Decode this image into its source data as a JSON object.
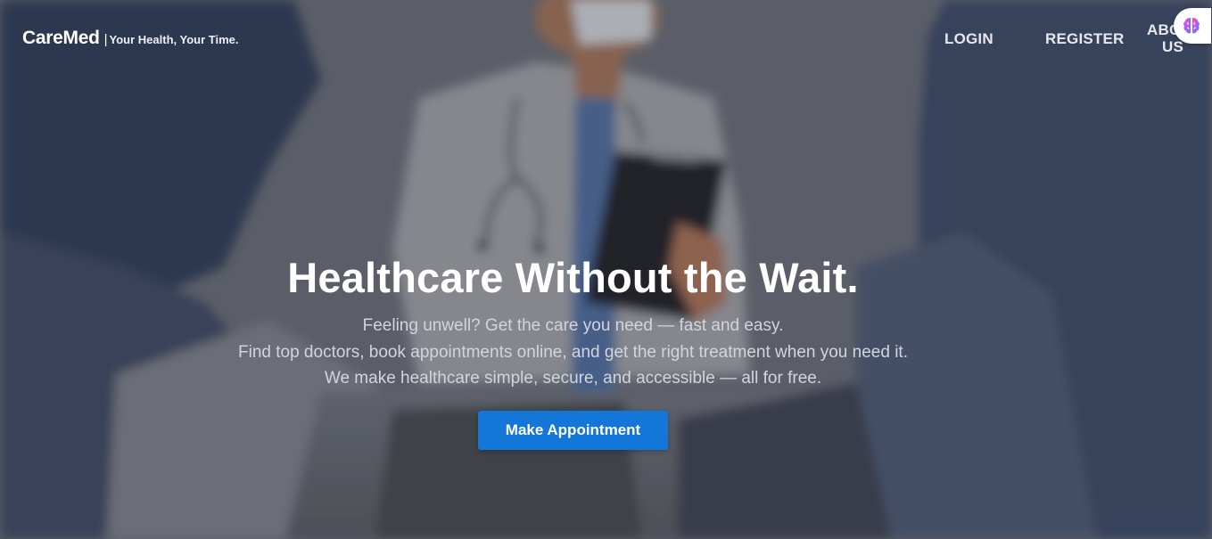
{
  "brand": {
    "name": "CareMed",
    "separator": "|",
    "tagline": "Your Health, Your Time."
  },
  "nav": {
    "login": "LOGIN",
    "register": "REGISTER",
    "about": "ABOUT US"
  },
  "extension": {
    "icon": "brain-icon"
  },
  "hero": {
    "headline": "Healthcare Without the Wait.",
    "lines": [
      "Feeling unwell? Get the care you need — fast and easy.",
      "Find top doctors, book appointments online, and get the right treatment when you need it.",
      "We make healthcare simple, secure, and accessible — all for free."
    ],
    "cta_label": "Make Appointment",
    "background_illustration": "doctor-with-clipboard-illustration"
  },
  "colors": {
    "accent": "#1277d9",
    "overlay": "#5d6472",
    "text": "#ffffff"
  }
}
